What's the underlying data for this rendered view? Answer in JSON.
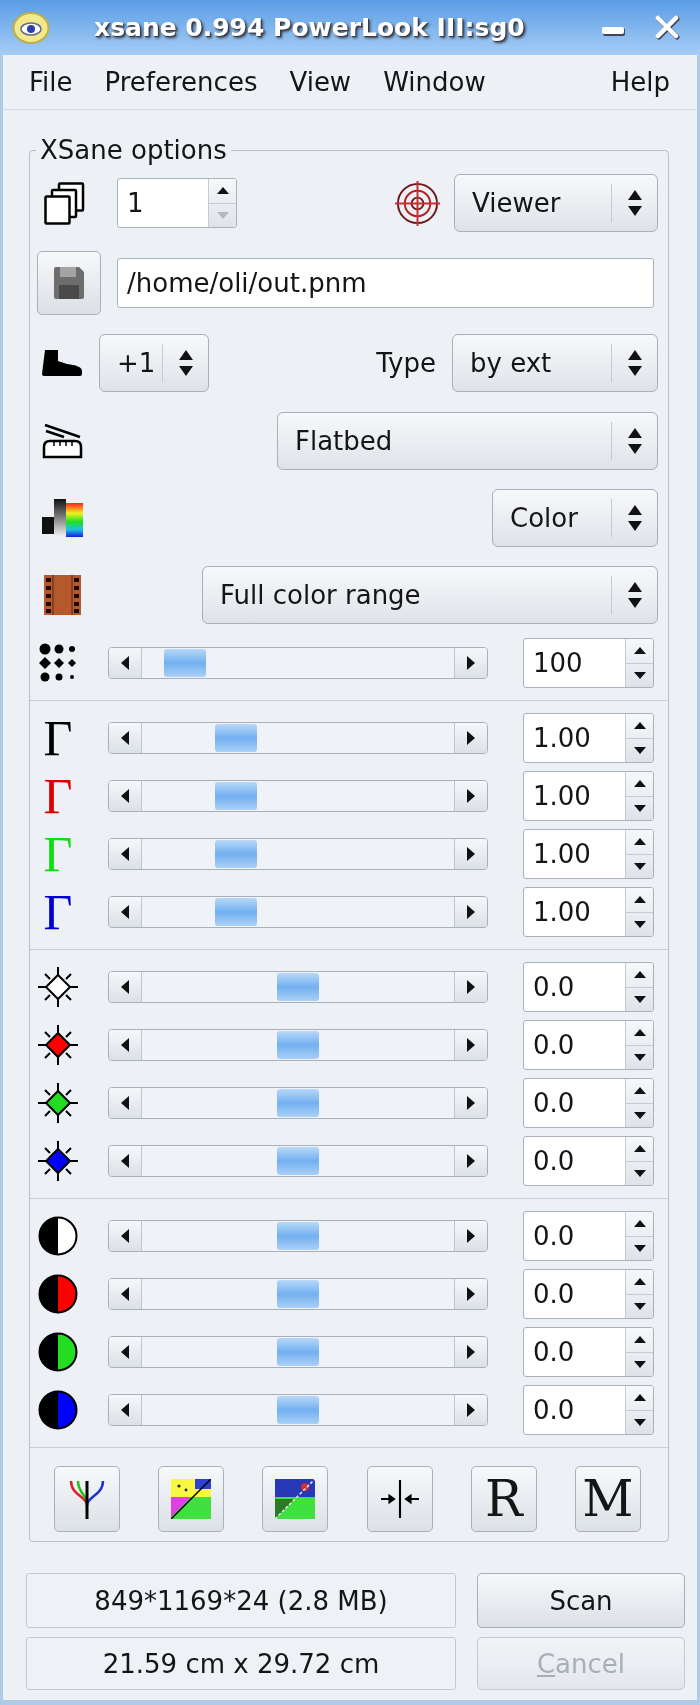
{
  "window": {
    "title": "xsane 0.994 PowerLook III:sg0"
  },
  "menu": [
    {
      "label": "File"
    },
    {
      "label": "Preferences"
    },
    {
      "label": "View"
    },
    {
      "label": "Window"
    },
    {
      "label": "Help"
    }
  ],
  "options": {
    "title": "XSane options",
    "copies": {
      "value": "1",
      "decrement_disabled": true
    },
    "target": {
      "value": "Viewer"
    },
    "filename": {
      "value": "/home/oli/out.pnm"
    },
    "step": {
      "value": "+1"
    },
    "type": {
      "label": "Type",
      "value": "by ext"
    },
    "source": {
      "value": "Flatbed"
    },
    "mode": {
      "value": "Color"
    },
    "range": {
      "value": "Full color range"
    },
    "slider_groups": [
      {
        "rows": [
          {
            "kind": "resolution",
            "level": 0.08,
            "value": "100"
          }
        ]
      },
      {
        "rows": [
          {
            "kind": "gamma",
            "symbol": "Γ",
            "color": "#000000",
            "level": 0.27,
            "value": "1.00"
          },
          {
            "kind": "gamma",
            "symbol": "Γ",
            "color": "#dd0000",
            "level": 0.27,
            "value": "1.00"
          },
          {
            "kind": "gamma",
            "symbol": "Γ",
            "color": "#10dd10",
            "level": 0.27,
            "value": "1.00"
          },
          {
            "kind": "gamma",
            "symbol": "Γ",
            "color": "#0000cc",
            "level": 0.27,
            "value": "1.00"
          }
        ]
      },
      {
        "rows": [
          {
            "kind": "brightness",
            "color": "#ffffff",
            "level": 0.5,
            "value": "0.0"
          },
          {
            "kind": "brightness",
            "color": "#ff0000",
            "level": 0.5,
            "value": "0.0"
          },
          {
            "kind": "brightness",
            "color": "#22dd22",
            "level": 0.5,
            "value": "0.0"
          },
          {
            "kind": "brightness",
            "color": "#0000ff",
            "level": 0.5,
            "value": "0.0"
          }
        ]
      },
      {
        "rows": [
          {
            "kind": "contrast",
            "color": "#ffffff",
            "level": 0.5,
            "value": "0.0"
          },
          {
            "kind": "contrast",
            "color": "#ff0000",
            "level": 0.5,
            "value": "0.0"
          },
          {
            "kind": "contrast",
            "color": "#22dd22",
            "level": 0.5,
            "value": "0.0"
          },
          {
            "kind": "contrast",
            "color": "#0000ff",
            "level": 0.5,
            "value": "0.0"
          }
        ]
      }
    ],
    "tools": [
      {
        "kind": "fork"
      },
      {
        "kind": "photo-bright"
      },
      {
        "kind": "photo-dark"
      },
      {
        "kind": "pinch"
      },
      {
        "kind": "letter",
        "glyph": "R"
      },
      {
        "kind": "letter",
        "glyph": "M"
      }
    ]
  },
  "status": {
    "info": "849*1169*24 (2.8 MB)",
    "size": "21.59 cm x 29.72 cm"
  },
  "buttons": [
    {
      "label": "Scan",
      "disabled": false,
      "mnemonic": false
    },
    {
      "label": "Cancel",
      "disabled": true,
      "mnemonic": true
    }
  ]
}
